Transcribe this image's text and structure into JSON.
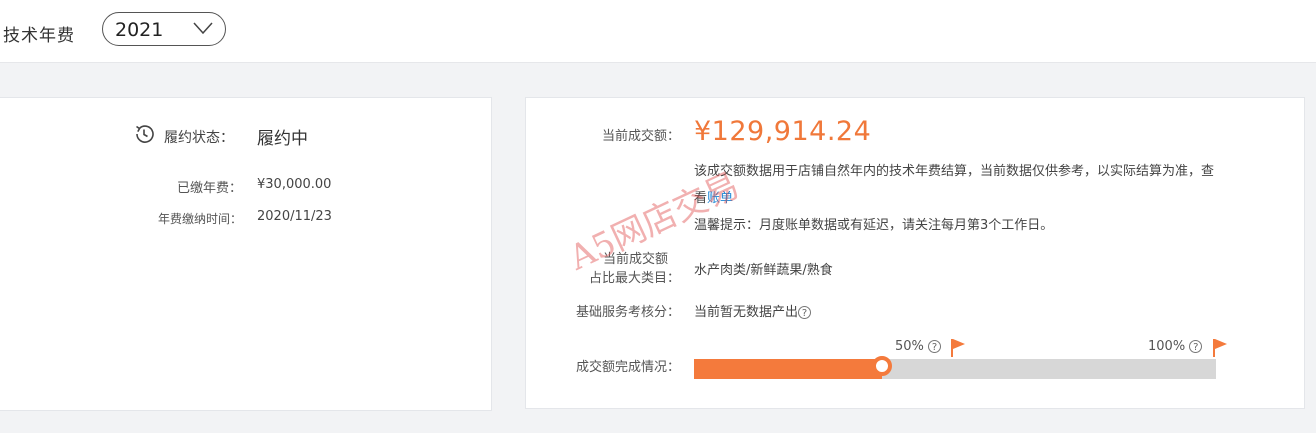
{
  "header": {
    "label": "技术年费",
    "year": "2021"
  },
  "left_panel": {
    "status_label": "履约状态：",
    "status_value": "履约中",
    "paid_label": "已缴年费：",
    "paid_value": "¥30,000.00",
    "paid_time_label": "年费缴纳时间：",
    "paid_time_value": "2020/11/23"
  },
  "right_panel": {
    "current_amount_label": "当前成交额：",
    "current_amount_value": "¥129,914.24",
    "note_text": "该成交额数据用于店铺自然年内的技术年费结算，当前数据仅供参考，以实际结算为准，查看",
    "note_link": "账单",
    "tip": "温馨提示：月度账单数据或有延迟，请关注每月第3个工作日。",
    "category_label_line1": "当前成交额",
    "category_label_line2": "占比最大类目：",
    "category_value": "水产肉类/新鲜蔬果/熟食",
    "service_label": "基础服务考核分：",
    "service_value": "当前暂无数据产出",
    "progress_label": "成交额完成情况：",
    "progress": 0.36,
    "milestone_1": "50%",
    "milestone_2": "100%",
    "accent_color": "#f47a3c"
  },
  "watermark": "A5网店交易"
}
